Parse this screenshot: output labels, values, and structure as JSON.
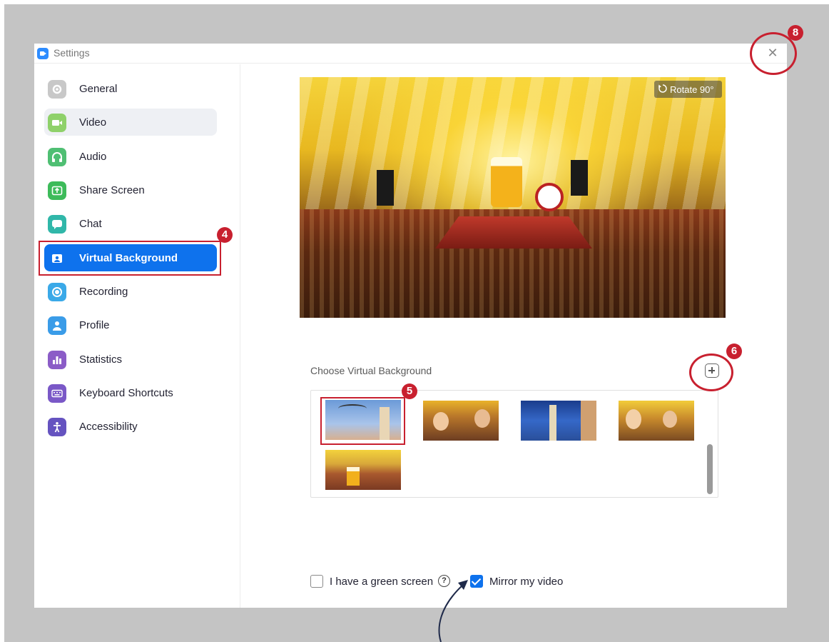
{
  "window": {
    "title": "Settings"
  },
  "sidebar": {
    "items": [
      {
        "label": "General",
        "icon": "gear-icon",
        "color": "#c8c8c8"
      },
      {
        "label": "Video",
        "icon": "video-icon",
        "color": "#8fd16a"
      },
      {
        "label": "Audio",
        "icon": "headphones-icon",
        "color": "#4fbf73"
      },
      {
        "label": "Share Screen",
        "icon": "share-screen-icon",
        "color": "#3dbb5a"
      },
      {
        "label": "Chat",
        "icon": "chat-icon",
        "color": "#30b7a9"
      },
      {
        "label": "Virtual Background",
        "icon": "person-card-icon",
        "color": "#0e72ed"
      },
      {
        "label": "Recording",
        "icon": "record-icon",
        "color": "#3aa9e8"
      },
      {
        "label": "Profile",
        "icon": "profile-icon",
        "color": "#3a9ce8"
      },
      {
        "label": "Statistics",
        "icon": "bar-chart-icon",
        "color": "#8b5cc7"
      },
      {
        "label": "Keyboard Shortcuts",
        "icon": "keyboard-icon",
        "color": "#7a58c7"
      },
      {
        "label": "Accessibility",
        "icon": "accessibility-icon",
        "color": "#6553c0"
      }
    ],
    "active_index": 5,
    "hover_index": 1
  },
  "preview": {
    "rotate_label": "Rotate 90°"
  },
  "backgrounds": {
    "section_label": "Choose Virtual Background",
    "selected_index": 0
  },
  "options": {
    "green_screen_label": "I have a green screen",
    "green_screen_checked": false,
    "mirror_label": "Mirror my video",
    "mirror_checked": true
  },
  "annotations": {
    "step_4": "4",
    "step_5": "5",
    "step_6": "6",
    "step_8": "8",
    "color": "#c8202f"
  }
}
